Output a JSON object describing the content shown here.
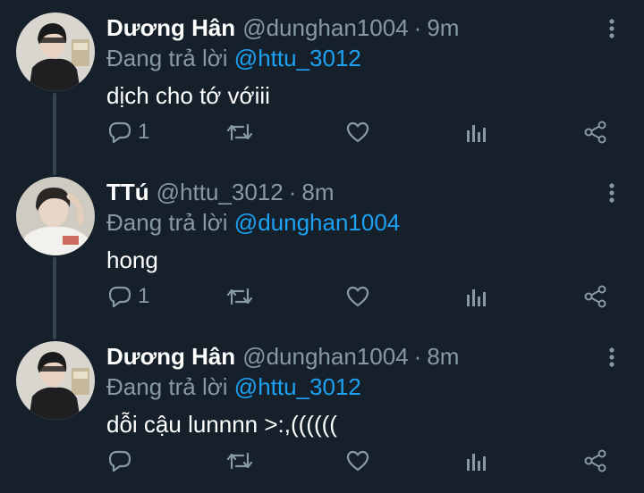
{
  "colors": {
    "background": "#15202b",
    "text_primary": "#ffffff",
    "text_secondary": "#8899a6",
    "accent": "#1da1f2",
    "thread_line": "#38444d"
  },
  "tweets": [
    {
      "name": "Dương Hân",
      "handle": "@dunghan1004",
      "dot": "·",
      "time": "9m",
      "reply_prefix": "Đang trả lời",
      "reply_to": "@httu_3012",
      "text": "dịch cho tớ vớiii",
      "reply_count": "1",
      "icons": [
        "reply-icon",
        "retweet-icon",
        "like-icon",
        "analytics-icon",
        "share-icon",
        "more-icon"
      ]
    },
    {
      "name": "TTú",
      "handle": "@httu_3012",
      "dot": "·",
      "time": "8m",
      "reply_prefix": "Đang trả lời",
      "reply_to": "@dunghan1004",
      "text": "hong",
      "reply_count": "1",
      "icons": [
        "reply-icon",
        "retweet-icon",
        "like-icon",
        "analytics-icon",
        "share-icon",
        "more-icon"
      ]
    },
    {
      "name": "Dương Hân",
      "handle": "@dunghan1004",
      "dot": "·",
      "time": "8m",
      "reply_prefix": "Đang trả lời",
      "reply_to": "@httu_3012",
      "text": "dỗi cậu lunnnn >:,((((((",
      "reply_count": "",
      "icons": [
        "reply-icon",
        "retweet-icon",
        "like-icon",
        "analytics-icon",
        "share-icon",
        "more-icon"
      ]
    }
  ]
}
